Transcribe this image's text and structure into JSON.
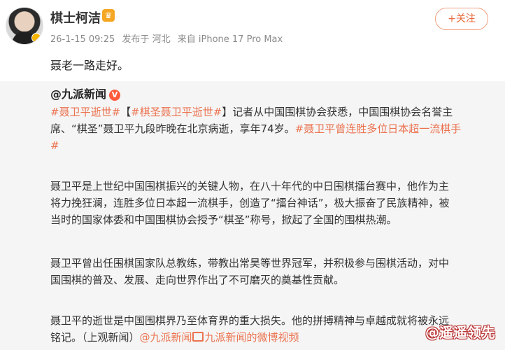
{
  "header": {
    "author_name": "棋士柯洁",
    "vip_icon": "vip-crown-icon",
    "timestamp": "26-1-15 09:25",
    "location": "发布于 河北",
    "device": "来自 iPhone 17 Pro Max",
    "follow_label": "+关注"
  },
  "post": {
    "text": "聂老一路走好。"
  },
  "repost": {
    "source_name": "@九派新闻",
    "verified_badge": "V",
    "para1": {
      "line1": [
        {
          "type": "tag",
          "text": "#聂卫平逝世#"
        },
        {
          "type": "text",
          "text": "【"
        },
        {
          "type": "tag",
          "text": "#棋圣聂卫平逝世#"
        },
        {
          "type": "text",
          "text": "】记者从中国围棋协会获悉，中国围棋协会名誉主"
        }
      ],
      "line2": [
        {
          "type": "text",
          "text": "席、“棋圣”聂卫平九段昨晚在北京病逝，享年74岁。"
        },
        {
          "type": "tag",
          "text": "#聂卫平曾连胜多位日本超一流棋手"
        }
      ],
      "line3": [
        {
          "type": "tag",
          "text": "#"
        }
      ]
    },
    "para2": [
      "聂卫平是上世纪中国围棋振兴的关键人物，在八十年代的中日围棋擂台赛中，他作为主",
      "将力挽狂澜，连胜多位日本超一流棋手，创造了“擂台神话”，极大振奋了民族精神，被",
      "当时的国家体委和中国围棋协会授予“棋圣”称号，掀起了全国的围棋热潮。"
    ],
    "para3": [
      "聂卫平曾出任围棋国家队总教练，带教出常昊等世界冠军，并积极参与围棋活动，对中",
      "国围棋的普及、发展、走向世界作出了不可磨灭的奠基性贡献。"
    ],
    "para4": {
      "line1": "聂卫平的逝世是中国围棋界乃至体育界的重大损失。他的拼搏精神与卓越成就将被永远",
      "line2_text": "铭记。（上观新闻）",
      "line2_link1": "@九派新闻",
      "line2_link2": "九派新闻的微博视频"
    }
  },
  "watermark": "@遥遥领先",
  "colors": {
    "accent": "#eb7350",
    "repost_bg": "#f5f5f5"
  }
}
